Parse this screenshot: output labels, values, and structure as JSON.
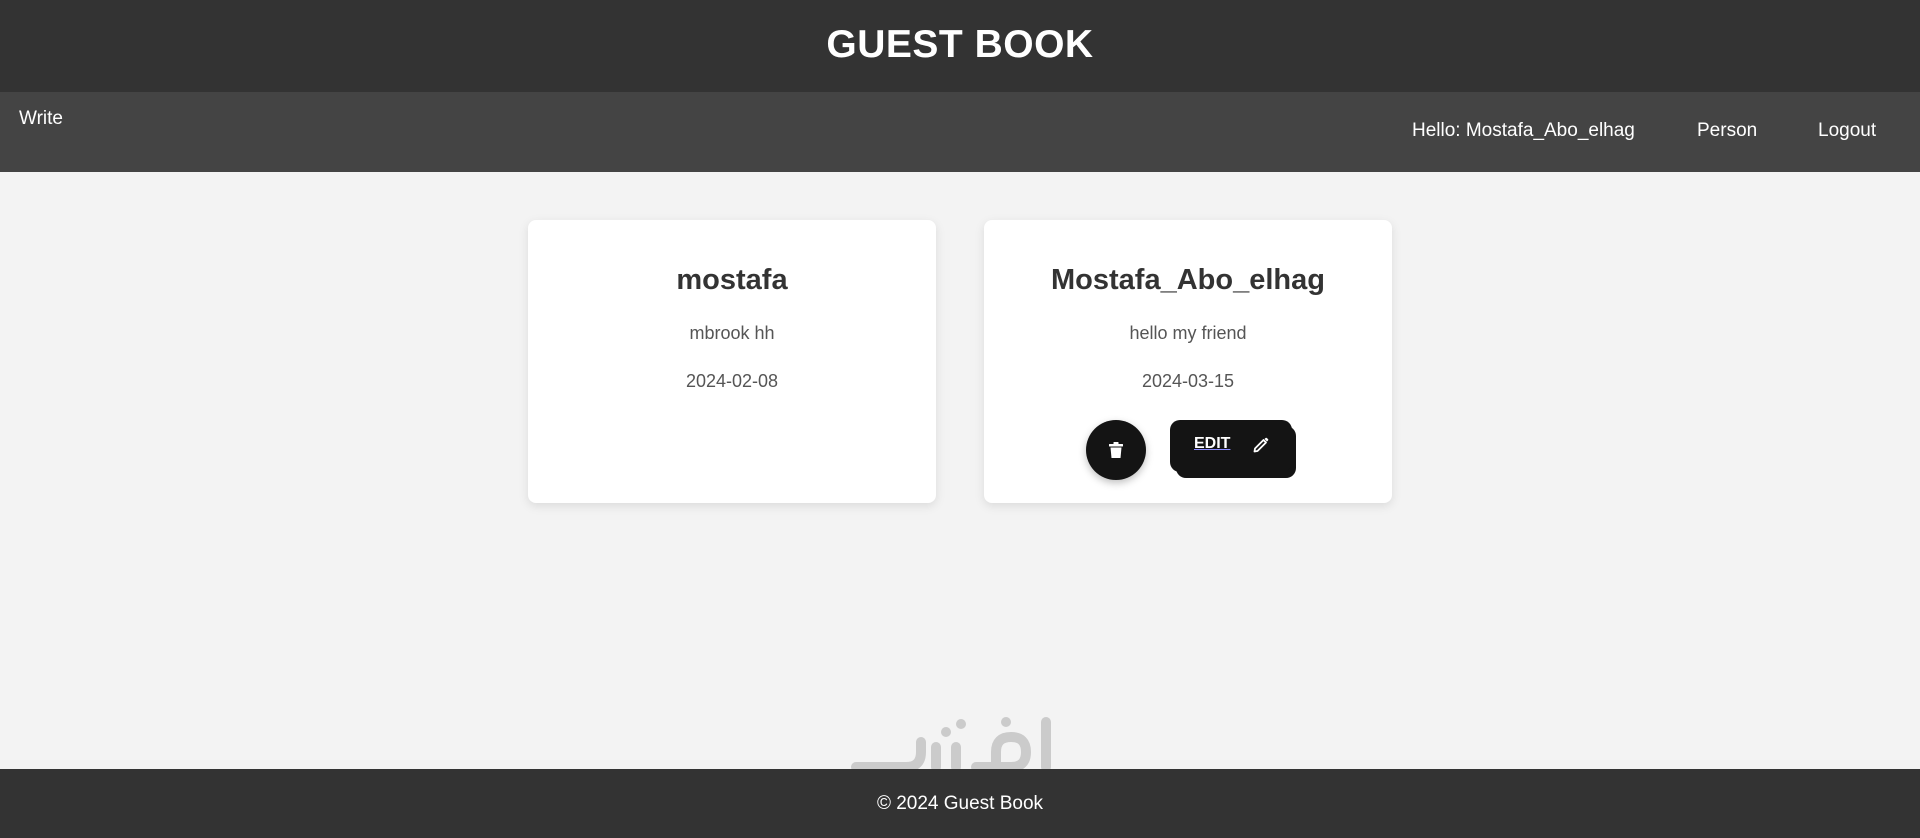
{
  "header": {
    "title": "GUEST BOOK"
  },
  "nav": {
    "write": "Write",
    "greeting": "Hello: Mostafa_Abo_elhag",
    "person": "Person",
    "logout": "Logout"
  },
  "entries": [
    {
      "name": "mostafa",
      "message": "mbrook hh",
      "date": "2024-02-08"
    },
    {
      "name": "Mostafa_Abo_elhag",
      "message": "hello my friend",
      "date": "2024-03-15",
      "edit_label": "EDIT"
    }
  ],
  "footer": {
    "text": "© 2024 Guest Book"
  },
  "colors": {
    "header_bg": "#333333",
    "nav_bg": "#444444",
    "page_bg": "#f3f3f3",
    "card_bg": "#ffffff",
    "button_bg": "#141414"
  },
  "icons": {
    "delete": "trash-icon",
    "edit": "pencil-icon"
  }
}
